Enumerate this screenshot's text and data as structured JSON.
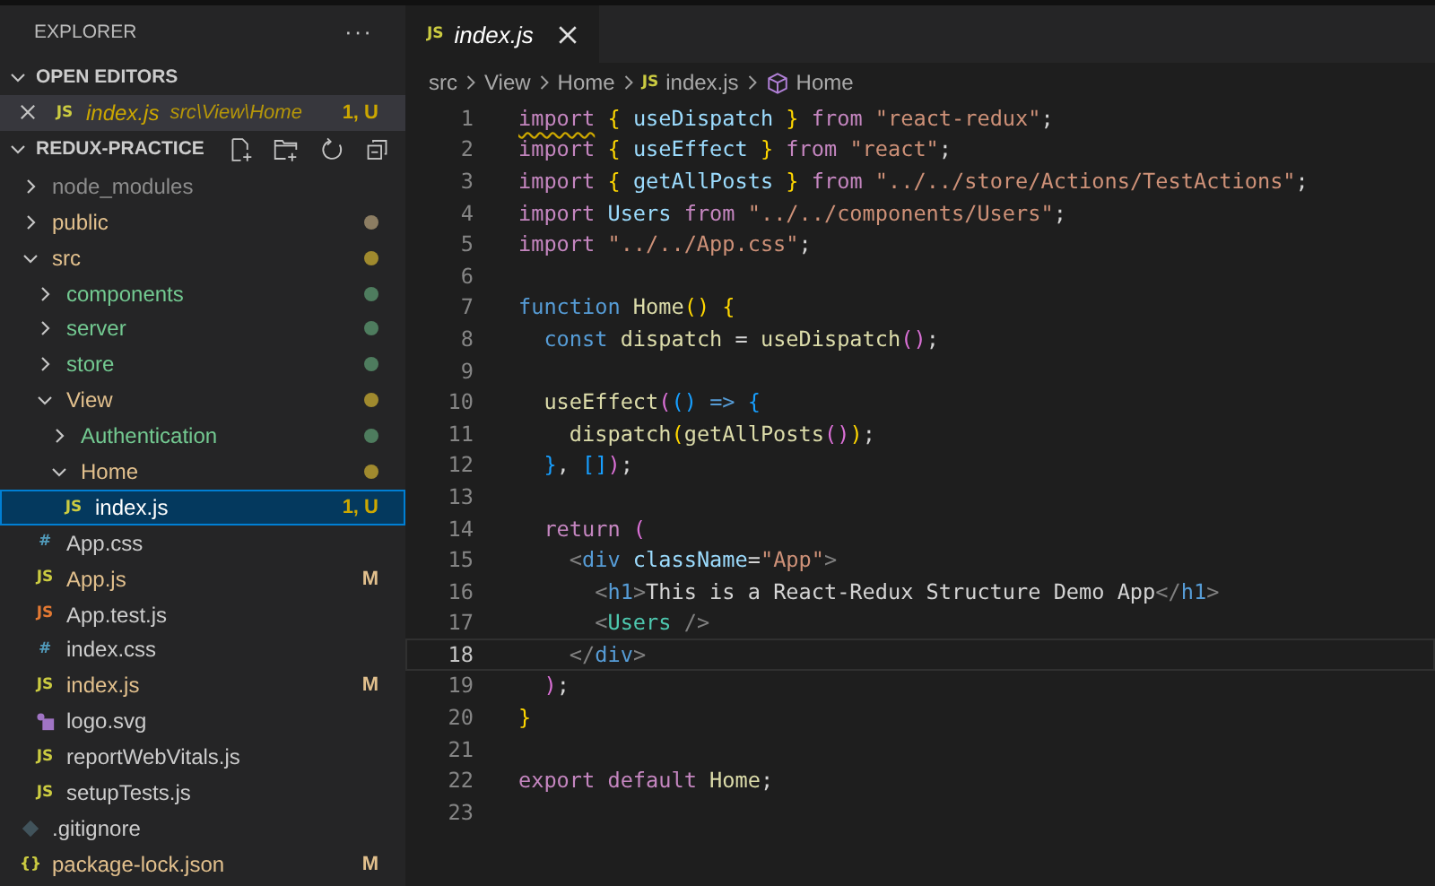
{
  "sidebar": {
    "title": "EXPLORER",
    "more": "···",
    "open_editors": {
      "title": "OPEN EDITORS",
      "expanded": true,
      "items": [
        {
          "kind": "js_file",
          "name": "index.js",
          "glyph": "JS",
          "path": "src\\View\\Home",
          "badge": "1, U",
          "color": "#cca700",
          "preview": true,
          "selected": true
        }
      ]
    },
    "project": {
      "title": "REDUX-PRACTICE",
      "expanded": true,
      "tree": [
        {
          "kind": "folder",
          "name": "node_modules",
          "color": "#8c8c8c",
          "expanded": false,
          "selected": false
        },
        {
          "kind": "folder",
          "name": "public",
          "color": "#e2c08d",
          "expanded": false,
          "selected": false,
          "dot": {
            "color": "#8c7d62"
          }
        },
        {
          "kind": "folder",
          "name": "src",
          "color": "#e2c08d",
          "expanded": true,
          "selected": false,
          "dot": {
            "color": "#a08a2e"
          },
          "children": [
            {
              "kind": "folder",
              "name": "components",
              "color": "#73c991",
              "expanded": false,
              "selected": false,
              "dot": {
                "color": "#4e7c5e"
              }
            },
            {
              "kind": "folder",
              "name": "server",
              "color": "#73c991",
              "expanded": false,
              "selected": false,
              "dot": {
                "color": "#4e7c5e"
              }
            },
            {
              "kind": "folder",
              "name": "store",
              "color": "#73c991",
              "expanded": false,
              "selected": false,
              "dot": {
                "color": "#4e7c5e"
              }
            },
            {
              "kind": "folder",
              "name": "View",
              "color": "#e2c08d",
              "expanded": true,
              "selected": false,
              "dot": {
                "color": "#a08a2e"
              },
              "children": [
                {
                  "kind": "folder",
                  "name": "Authentication",
                  "color": "#73c991",
                  "expanded": false,
                  "selected": false,
                  "dot": {
                    "color": "#4e7c5e"
                  }
                },
                {
                  "kind": "folder",
                  "name": "Home",
                  "color": "#e2c08d",
                  "expanded": true,
                  "selected": false,
                  "dot": {
                    "color": "#a08a2e"
                  },
                  "children": [
                    {
                      "kind": "js_file",
                      "name": "index.js",
                      "glyph": "JS",
                      "color": "#cca700",
                      "badge": "1, U",
                      "selected": true
                    }
                  ]
                }
              ]
            },
            {
              "kind": "css_file",
              "name": "App.css",
              "glyph": "#",
              "color": "#cccccc",
              "selected": false
            },
            {
              "kind": "js_file",
              "name": "App.js",
              "glyph": "JS",
              "color": "#e2c08d",
              "badge": "M",
              "selected": false
            },
            {
              "kind": "test_file",
              "name": "App.test.js",
              "glyph": "JS",
              "color": "#cccccc",
              "selected": false
            },
            {
              "kind": "css_file",
              "name": "index.css",
              "glyph": "#",
              "color": "#cccccc",
              "selected": false
            },
            {
              "kind": "js_file",
              "name": "index.js",
              "glyph": "JS",
              "color": "#e2c08d",
              "badge": "M",
              "selected": false
            },
            {
              "kind": "image_file",
              "name": "logo.svg",
              "color": "#cccccc",
              "selected": false
            },
            {
              "kind": "js_file",
              "name": "reportWebVitals.js",
              "glyph": "JS",
              "color": "#cccccc",
              "selected": false
            },
            {
              "kind": "js_file",
              "name": "setupTests.js",
              "glyph": "JS",
              "color": "#cccccc",
              "selected": false
            }
          ]
        },
        {
          "kind": "git_file",
          "name": ".gitignore",
          "color": "#cccccc",
          "selected": false
        },
        {
          "kind": "json_file",
          "name": "package-lock.json",
          "glyph": "{}",
          "color": "#e2c08d",
          "badge": "M",
          "selected": false
        }
      ]
    }
  },
  "tabs": [
    {
      "label": "index.js",
      "glyph": "JS",
      "preview": true,
      "selected": true
    }
  ],
  "breadcrumbs": [
    {
      "kind": "folder",
      "label": "src"
    },
    {
      "kind": "folder",
      "label": "View"
    },
    {
      "kind": "folder",
      "label": "Home"
    },
    {
      "kind": "file",
      "label": "index.js",
      "glyph": "JS"
    },
    {
      "kind": "symbol",
      "label": "Home"
    }
  ],
  "code": [
    {
      "number": "1",
      "current": false,
      "tokens": [
        {
          "kind": "keyword_warning",
          "text": "import"
        },
        {
          "kind": "brace",
          "text": " { "
        },
        {
          "kind": "variable",
          "text": "useDispatch"
        },
        {
          "kind": "brace",
          "text": " } "
        },
        {
          "kind": "keyword",
          "text": "from "
        },
        {
          "kind": "string",
          "text": "\"react-redux\""
        },
        {
          "kind": "plain",
          "text": ";"
        }
      ]
    },
    {
      "number": "2",
      "current": false,
      "tokens": [
        {
          "kind": "keyword",
          "text": "import"
        },
        {
          "kind": "brace",
          "text": " { "
        },
        {
          "kind": "variable",
          "text": "useEffect"
        },
        {
          "kind": "brace",
          "text": " } "
        },
        {
          "kind": "keyword",
          "text": "from "
        },
        {
          "kind": "string",
          "text": "\"react\""
        },
        {
          "kind": "plain",
          "text": ";"
        }
      ]
    },
    {
      "number": "3",
      "current": false,
      "tokens": [
        {
          "kind": "keyword",
          "text": "import"
        },
        {
          "kind": "brace",
          "text": " { "
        },
        {
          "kind": "variable",
          "text": "getAllPosts"
        },
        {
          "kind": "brace",
          "text": " } "
        },
        {
          "kind": "keyword",
          "text": "from "
        },
        {
          "kind": "string",
          "text": "\"../../store/Actions/TestActions\""
        },
        {
          "kind": "plain",
          "text": ";"
        }
      ]
    },
    {
      "number": "4",
      "current": false,
      "tokens": [
        {
          "kind": "keyword",
          "text": "import "
        },
        {
          "kind": "variable",
          "text": "Users "
        },
        {
          "kind": "keyword",
          "text": "from "
        },
        {
          "kind": "string",
          "text": "\"../../components/Users\""
        },
        {
          "kind": "plain",
          "text": ";"
        }
      ]
    },
    {
      "number": "5",
      "current": false,
      "tokens": [
        {
          "kind": "keyword",
          "text": "import "
        },
        {
          "kind": "string",
          "text": "\"../../App.css\""
        },
        {
          "kind": "plain",
          "text": ";"
        }
      ]
    },
    {
      "number": "6",
      "current": false
    },
    {
      "number": "7",
      "current": false,
      "tokens": [
        {
          "kind": "declaration",
          "text": "function "
        },
        {
          "kind": "function",
          "text": "Home"
        },
        {
          "kind": "brace",
          "text": "() {"
        }
      ]
    },
    {
      "number": "8",
      "current": false,
      "tokens": [
        {
          "kind": "declaration",
          "text": "  const "
        },
        {
          "kind": "function",
          "text": "dispatch"
        },
        {
          "kind": "plain",
          "text": " = "
        },
        {
          "kind": "function",
          "text": "useDispatch"
        },
        {
          "kind": "bracket2",
          "text": "()"
        },
        {
          "kind": "plain",
          "text": ";"
        }
      ]
    },
    {
      "number": "9",
      "current": false
    },
    {
      "number": "10",
      "current": false,
      "tokens": [
        {
          "kind": "function",
          "text": "  useEffect"
        },
        {
          "kind": "bracket2",
          "text": "("
        },
        {
          "kind": "bracket3",
          "text": "() "
        },
        {
          "kind": "declaration",
          "text": "=>"
        },
        {
          "kind": "bracket3",
          "text": " {"
        }
      ]
    },
    {
      "number": "11",
      "current": false,
      "tokens": [
        {
          "kind": "function",
          "text": "    dispatch"
        },
        {
          "kind": "brace",
          "text": "("
        },
        {
          "kind": "function",
          "text": "getAllPosts"
        },
        {
          "kind": "bracket2",
          "text": "()"
        },
        {
          "kind": "brace",
          "text": ")"
        },
        {
          "kind": "plain",
          "text": ";"
        }
      ]
    },
    {
      "number": "12",
      "current": false,
      "tokens": [
        {
          "kind": "bracket3",
          "text": "  }"
        },
        {
          "kind": "plain",
          "text": ", "
        },
        {
          "kind": "bracket3",
          "text": "[]"
        },
        {
          "kind": "bracket2",
          "text": ")"
        },
        {
          "kind": "plain",
          "text": ";"
        }
      ]
    },
    {
      "number": "13",
      "current": false
    },
    {
      "number": "14",
      "current": false,
      "tokens": [
        {
          "kind": "keyword",
          "text": "  return"
        },
        {
          "kind": "bracket2",
          "text": " ("
        }
      ]
    },
    {
      "number": "15",
      "current": false,
      "tokens": [
        {
          "kind": "tag_punct",
          "text": "    <"
        },
        {
          "kind": "tag",
          "text": "div"
        },
        {
          "kind": "variable",
          "text": " className"
        },
        {
          "kind": "plain",
          "text": "="
        },
        {
          "kind": "string",
          "text": "\"App\""
        },
        {
          "kind": "tag_punct",
          "text": ">"
        }
      ]
    },
    {
      "number": "16",
      "current": false,
      "tokens": [
        {
          "kind": "tag_punct",
          "text": "      <"
        },
        {
          "kind": "tag",
          "text": "h1"
        },
        {
          "kind": "tag_punct",
          "text": ">"
        },
        {
          "kind": "plain",
          "text": "This is a React-Redux Structure Demo App"
        },
        {
          "kind": "tag_punct",
          "text": "</"
        },
        {
          "kind": "tag",
          "text": "h1"
        },
        {
          "kind": "tag_punct",
          "text": ">"
        }
      ]
    },
    {
      "number": "17",
      "current": false,
      "tokens": [
        {
          "kind": "tag_punct",
          "text": "      <"
        },
        {
          "kind": "component",
          "text": "Users"
        },
        {
          "kind": "tag_punct",
          "text": " />"
        }
      ]
    },
    {
      "number": "18",
      "current": true,
      "tokens": [
        {
          "kind": "tag_punct",
          "text": "    </"
        },
        {
          "kind": "tag",
          "text": "div"
        },
        {
          "kind": "tag_punct",
          "text": ">"
        }
      ]
    },
    {
      "number": "19",
      "current": false,
      "tokens": [
        {
          "kind": "bracket2",
          "text": "  )"
        },
        {
          "kind": "plain",
          "text": ";"
        }
      ]
    },
    {
      "number": "20",
      "current": false,
      "tokens": [
        {
          "kind": "brace",
          "text": "}"
        }
      ]
    },
    {
      "number": "21",
      "current": false
    },
    {
      "number": "22",
      "current": false,
      "tokens": [
        {
          "kind": "keyword",
          "text": "export default "
        },
        {
          "kind": "function",
          "text": "Home"
        },
        {
          "kind": "plain",
          "text": ";"
        }
      ]
    },
    {
      "number": "23",
      "current": false
    }
  ]
}
